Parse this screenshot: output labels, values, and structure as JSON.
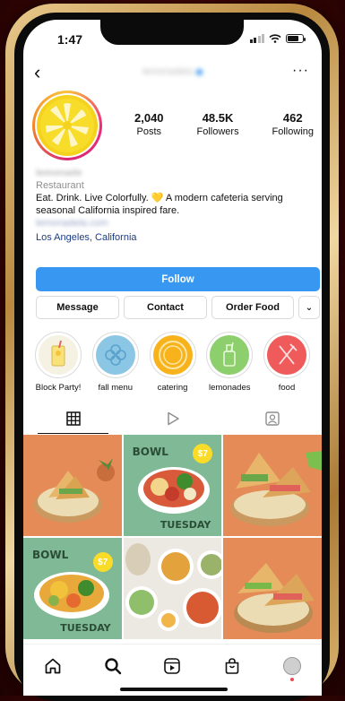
{
  "status": {
    "time": "1:47"
  },
  "header": {
    "username": "lemonadelu",
    "more_label": "···"
  },
  "stats": [
    {
      "value": "2,040",
      "label": "Posts"
    },
    {
      "value": "48.5K",
      "label": "Followers"
    },
    {
      "value": "462",
      "label": "Following"
    }
  ],
  "bio": {
    "name": "lemonade",
    "category": "Restaurant",
    "line1": "Eat. Drink. Live Colorfully. 💛 A modern cafeteria serving",
    "line2": "seasonal California inspired fare.",
    "link": "lemonadela.com",
    "location": "Los Angeles, California"
  },
  "buttons": {
    "follow": "Follow",
    "message": "Message",
    "contact": "Contact",
    "order": "Order Food",
    "more": "⌄"
  },
  "highlights": [
    {
      "label": "Block Party!",
      "color": "#f5f1e3"
    },
    {
      "label": "fall menu",
      "color": "#8cc6e5"
    },
    {
      "label": "catering",
      "color": "#f7b21c"
    },
    {
      "label": "lemonades",
      "color": "#8ccf6c"
    },
    {
      "label": "food",
      "color": "#ef5a5a"
    }
  ],
  "posts": [
    {
      "kind": "sandwich",
      "bg": "#e58b58"
    },
    {
      "kind": "bowl",
      "bg": "#7fb995",
      "title": "BOWL",
      "day": "TUESDAY",
      "price": "$7"
    },
    {
      "kind": "sandwich2",
      "bg": "#e58b58"
    },
    {
      "kind": "bowl",
      "bg": "#7fb995",
      "title": "BOWL",
      "day": "TUESDAY",
      "price": "$7"
    },
    {
      "kind": "spread",
      "bg": "#ece9e2"
    },
    {
      "kind": "sandwich3",
      "bg": "#e58b58"
    }
  ],
  "colors": {
    "accent": "#3897f0",
    "location": "#1b3d86"
  }
}
